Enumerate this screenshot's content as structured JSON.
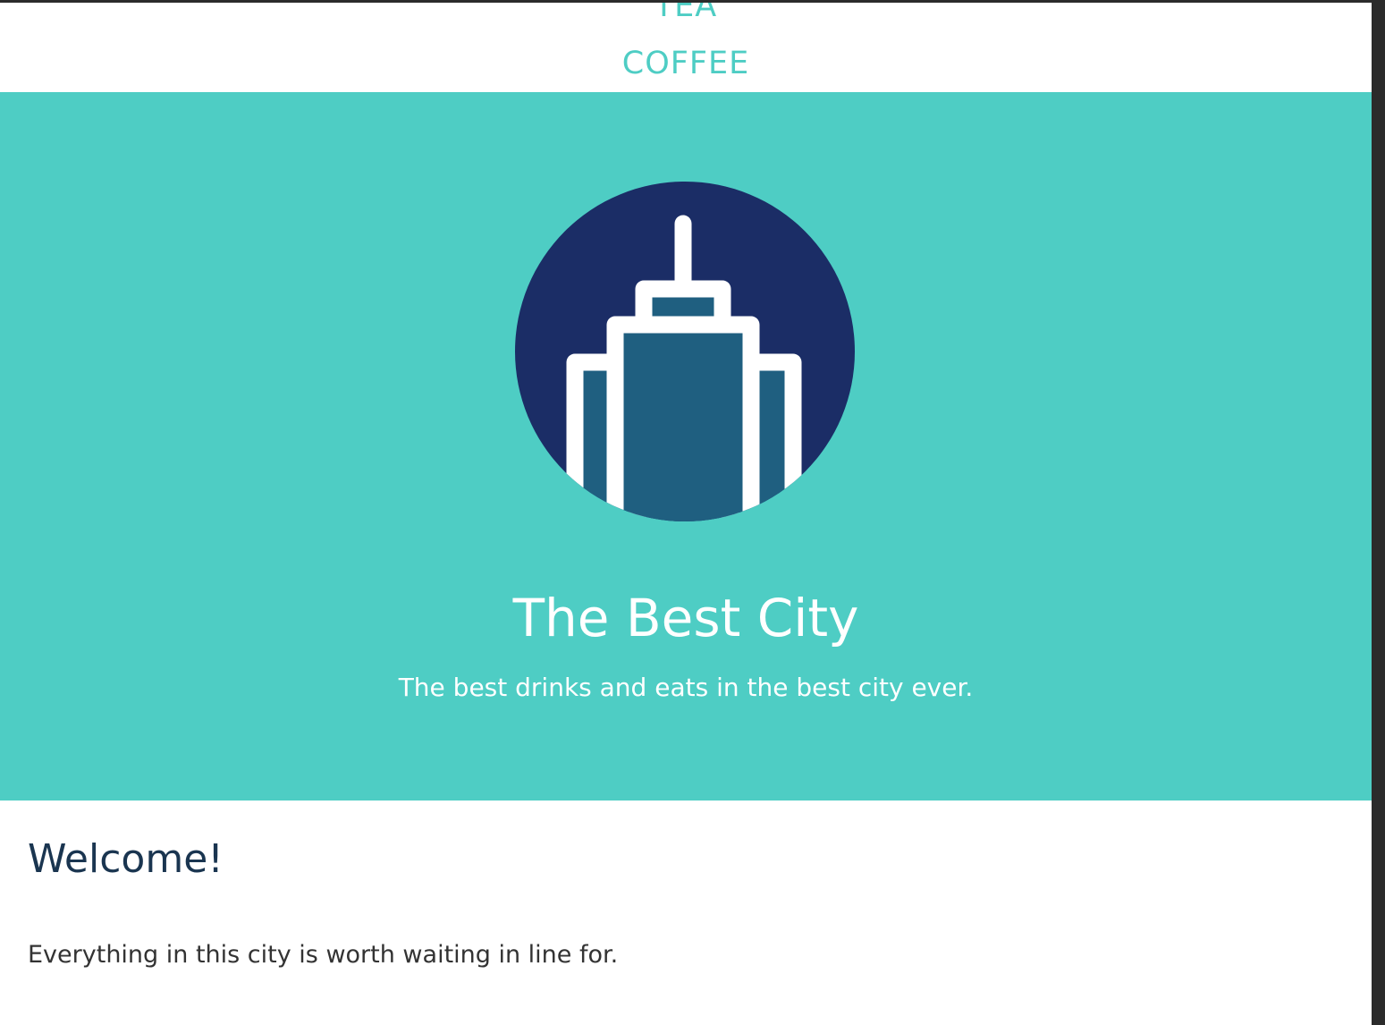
{
  "nav": {
    "items": [
      {
        "label": "TEA"
      },
      {
        "label": "COFFEE"
      }
    ]
  },
  "hero": {
    "title": "The Best City",
    "subtitle": "The best drinks and eats in the best city ever.",
    "logo_icon": "skyscraper-icon"
  },
  "main": {
    "heading": "Welcome!",
    "paragraph": "Everything in this city is worth waiting in line for."
  },
  "colors": {
    "accent": "#4ecdc4",
    "logo_circle": "#1b2d66",
    "building_fill": "#1f5f80",
    "heading": "#1a3550",
    "text": "#333333"
  }
}
